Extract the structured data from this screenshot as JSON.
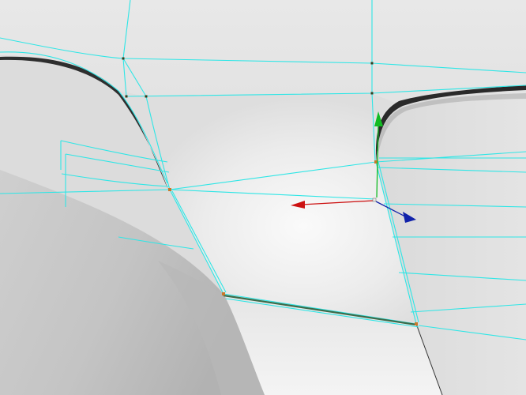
{
  "viewport": {
    "type": "3d-modeling-viewport",
    "view": "perspective",
    "shading": "smooth-shaded-with-wireframe"
  },
  "colors": {
    "background_surface": "#dcdcdc",
    "surface_light": "#f2f2f2",
    "surface_mid": "#d2d2d2",
    "surface_shadow": "#9a9a9a",
    "crease_dark": "#2e2e2e",
    "wireframe": "#2ee6e6",
    "vertex": "#3a3a1a",
    "selected_edge": "#3d6b4a",
    "selected_vertex": "#c8782a",
    "gizmo_x": "#cc1111",
    "gizmo_y": "#11bb22",
    "gizmo_z": "#1122aa"
  },
  "gizmo": {
    "type": "move-manipulator",
    "axes": [
      {
        "axis": "x",
        "icon": "x-axis-arrow-icon"
      },
      {
        "axis": "y",
        "icon": "y-axis-arrow-icon"
      },
      {
        "axis": "z",
        "icon": "z-axis-arrow-icon"
      }
    ]
  },
  "selection": {
    "component": "edge",
    "count": 1
  }
}
